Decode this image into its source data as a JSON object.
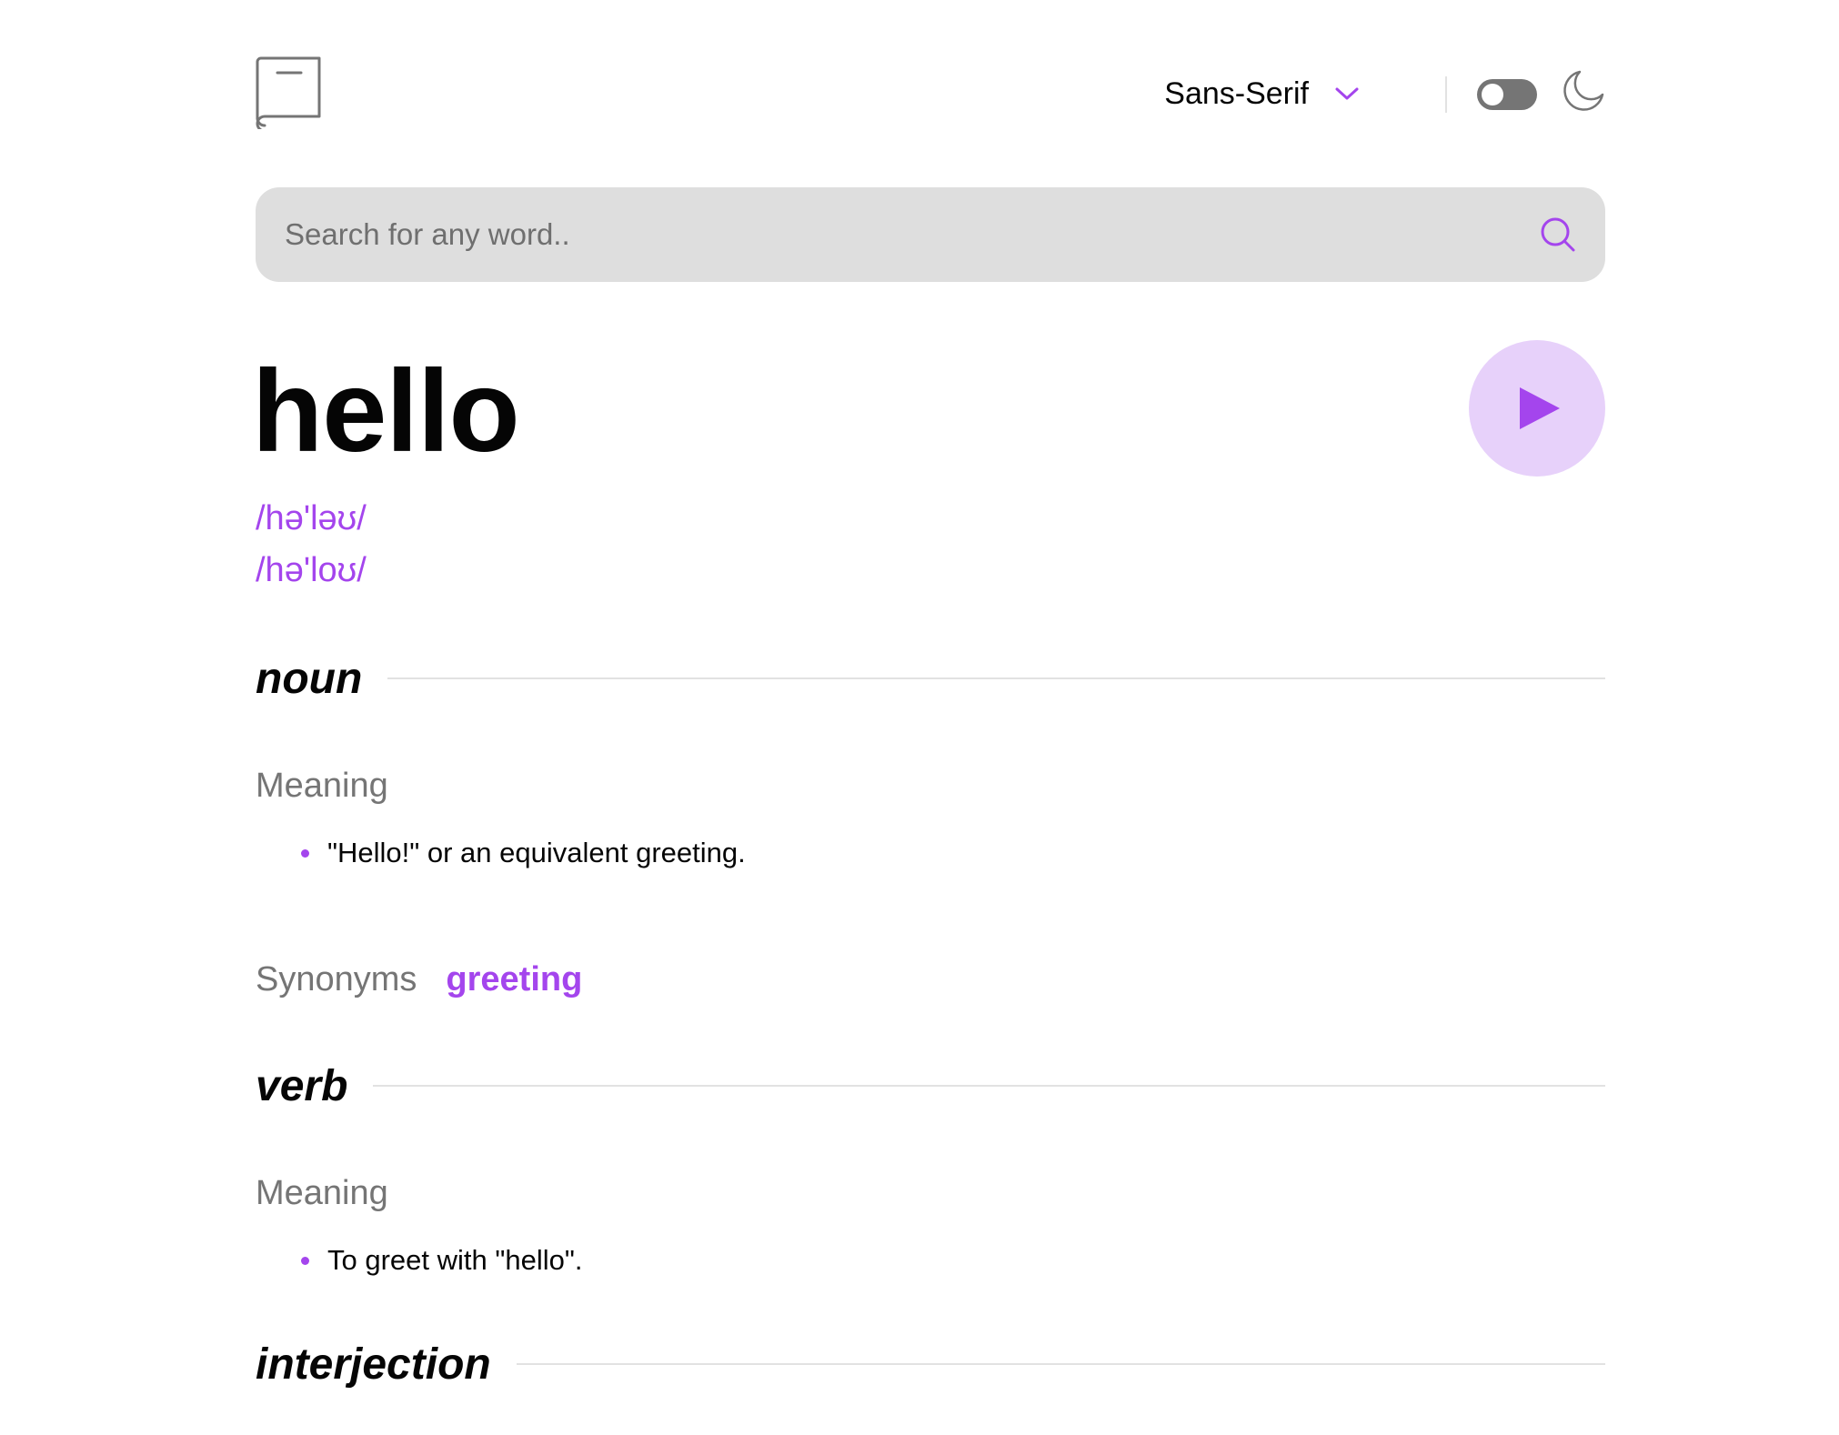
{
  "header": {
    "logo_icon": "book-icon",
    "font_select": {
      "selected": "Sans-Serif",
      "icon": "chevron-down-icon"
    },
    "theme_toggle": {
      "state": "off"
    },
    "theme_icon": "moon-icon"
  },
  "search": {
    "placeholder": "Search for any word..",
    "value": "",
    "icon": "search-icon"
  },
  "word": {
    "title": "hello",
    "phonetics": [
      "/hə'ləʊ/",
      "/hə'loʊ/"
    ],
    "play_icon": "play-icon"
  },
  "meanings": [
    {
      "part_of_speech": "noun",
      "heading": "Meaning",
      "definitions": [
        "\"Hello!\" or an equivalent greeting."
      ],
      "synonyms_label": "Synonyms",
      "synonyms": [
        "greeting"
      ]
    },
    {
      "part_of_speech": "verb",
      "heading": "Meaning",
      "definitions": [
        "To greet with \"hello\"."
      ]
    },
    {
      "part_of_speech": "interjection"
    }
  ],
  "colors": {
    "accent": "#a445ed",
    "accent_light": "#e7d1fa",
    "search_bg": "#dedede",
    "muted_text": "#757575",
    "divider": "#e2e2e2",
    "text": "#050505"
  }
}
